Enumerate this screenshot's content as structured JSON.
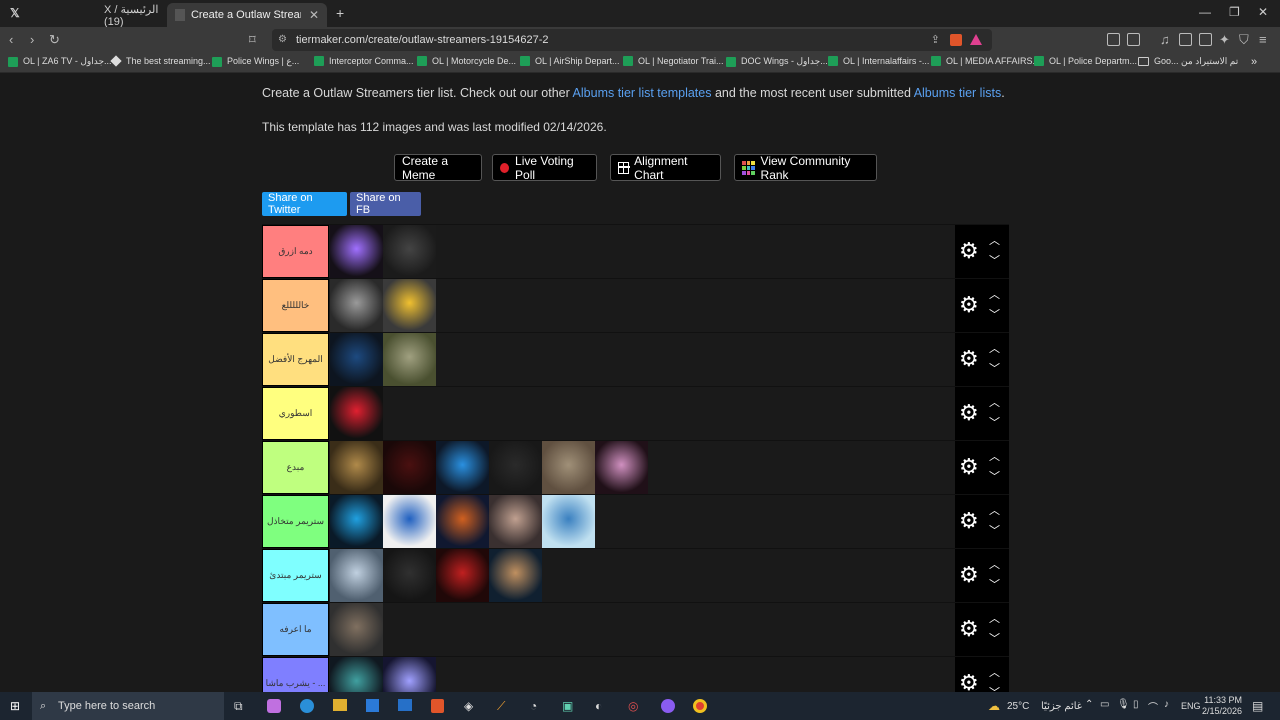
{
  "tabs": [
    {
      "label": "X / الرئيسية (19)",
      "active": false
    },
    {
      "label": "Create a Outlaw Streamers Tier L",
      "active": true
    }
  ],
  "new_tab": "+",
  "url": "tiermaker.com/create/outlaw-streamers-19154627-2",
  "bookmarks": [
    "OL | ZA6 TV - جداول...",
    "The best streaming...",
    "Police Wings | ع...",
    "Interceptor Comma...",
    "OL | Motorcycle De...",
    "OL | AirShip Depart...",
    "OL | Negotiator Trai...",
    "DOC Wings - جداول...",
    "OL | Internalaffairs -...",
    "OL | MEDIA AFFAIRS...",
    "OL | Police Departm...",
    "Goo... تم الاستيراد من"
  ],
  "intro": {
    "prefix": "Create a Outlaw Streamers tier list. Check out our other ",
    "link1": "Albums tier list templates",
    "middle": " and the most recent user submitted ",
    "link2": "Albums tier lists",
    "suffix": "."
  },
  "meta": "This template has 112 images and was last modified 02/14/2026.",
  "actions": {
    "meme": "Create a Meme",
    "poll": "Live Voting Poll",
    "alignment": "Alignment Chart",
    "community": "View Community Rank"
  },
  "share": {
    "twitter": "Share on Twitter",
    "fb": "Share on FB"
  },
  "tiers": [
    {
      "label": "دمه ازرق",
      "color": "#ff7f7f",
      "items": [
        [
          "#151018",
          "#a070ff"
        ],
        [
          "#1b1b1b",
          "#444444"
        ]
      ]
    },
    {
      "label": "خالللللع",
      "color": "#ffbf7f",
      "items": [
        [
          "#2a2a2a",
          "#9a9a9a"
        ],
        [
          "#3a3a3a",
          "#f0c030"
        ]
      ]
    },
    {
      "label": "المهرج الأفضل",
      "color": "#ffdf7f",
      "items": [
        [
          "#0d1520",
          "#1d4a80"
        ],
        [
          "#4a5030",
          "#a0a080"
        ]
      ]
    },
    {
      "label": "اسطوري",
      "color": "#ffff7f",
      "items": [
        [
          "#111111",
          "#e02030"
        ]
      ]
    },
    {
      "label": "مبدع",
      "color": "#bfff7f",
      "items": [
        [
          "#3a2d18",
          "#b08a4a"
        ],
        [
          "#1a0808",
          "#4a1010"
        ],
        [
          "#0d1828",
          "#2a90e0"
        ],
        [
          "#181818",
          "#2a2a2a"
        ],
        [
          "#605040",
          "#a09078"
        ],
        [
          "#201018",
          "#d090c0"
        ]
      ]
    },
    {
      "label": "ستريمر متخاذل",
      "color": "#7fff7f",
      "items": [
        [
          "#0a1a28",
          "#20a0e0"
        ],
        [
          "#f0f0f0",
          "#2060c0"
        ],
        [
          "#101830",
          "#d06020"
        ],
        [
          "#3a3030",
          "#c0a090"
        ],
        [
          "#c0e0f0",
          "#3a80c0"
        ]
      ]
    },
    {
      "label": "ستريمر مبتدئ",
      "color": "#7fffff",
      "items": [
        [
          "#506070",
          "#c0d0e0"
        ],
        [
          "#151515",
          "#303030"
        ],
        [
          "#200808",
          "#c02020"
        ],
        [
          "#102030",
          "#c09060"
        ]
      ]
    },
    {
      "label": "ما اعرفه",
      "color": "#7fbfff",
      "items": [
        [
          "#303030",
          "#807060"
        ]
      ]
    },
    {
      "label": "يشرب ماشا - ...",
      "color": "#7f7fff",
      "items": [
        [
          "#101820",
          "#40a0a0"
        ],
        [
          "#151530",
          "#a0a0ff"
        ]
      ]
    }
  ],
  "tier_controls": {
    "settings_icon": "gear-icon",
    "up_icon": "chevron-up-icon",
    "down_icon": "chevron-down-icon"
  },
  "taskbar": {
    "search_placeholder": "Type here to search",
    "weather_temp": "25°C",
    "weather_text": "غائم جزئيًا",
    "language": "ENG",
    "time": "11:33 PM",
    "date": "2/15/2026"
  }
}
